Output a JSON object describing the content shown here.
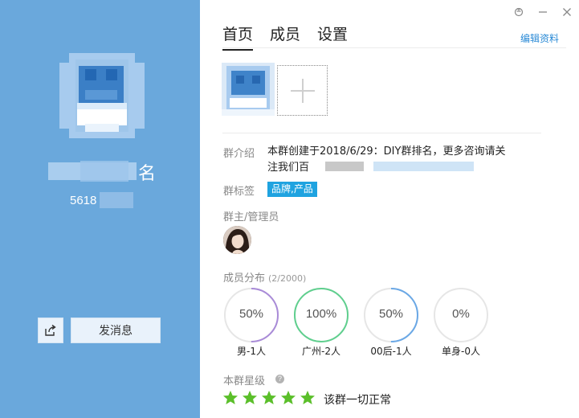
{
  "window": {
    "controls": [
      "skin-icon",
      "minimize-icon",
      "close-icon"
    ]
  },
  "profile": {
    "name_visible": "名",
    "id_prefix": "5618",
    "send_label": "发消息",
    "share_icon": "share-icon"
  },
  "tabs": [
    {
      "label": "首页",
      "active": true
    },
    {
      "label": "成员",
      "active": false
    },
    {
      "label": "设置",
      "active": false
    }
  ],
  "edit_label": "编辑资料",
  "album": {
    "add_icon": "plus-icon"
  },
  "intro": {
    "label": "群介绍",
    "text_line1": "本群创建于2018/6/29：DIY群排名，更多咨询请关",
    "text_line2": "注我们百"
  },
  "tags": {
    "label": "群标签",
    "items": [
      "品牌,产品"
    ]
  },
  "admins": {
    "label": "群主/管理员"
  },
  "distribution": {
    "label": "成员分布",
    "count": "(2/2000)",
    "stats": [
      {
        "percent": "50%",
        "value": 50,
        "caption": "男-1人",
        "color": "#a98bd8"
      },
      {
        "percent": "100%",
        "value": 100,
        "caption": "广州-2人",
        "color": "#5fcf8e"
      },
      {
        "percent": "50%",
        "value": 50,
        "caption": "00后-1人",
        "color": "#6aa8e6"
      },
      {
        "percent": "0%",
        "value": 0,
        "caption": "单身-0人",
        "color": "#e6e6e6"
      }
    ]
  },
  "level": {
    "label": "本群星级",
    "help_icon": "help-icon",
    "stars": 5,
    "star_color": "#5bbf2a",
    "text": "该群一切正常"
  }
}
